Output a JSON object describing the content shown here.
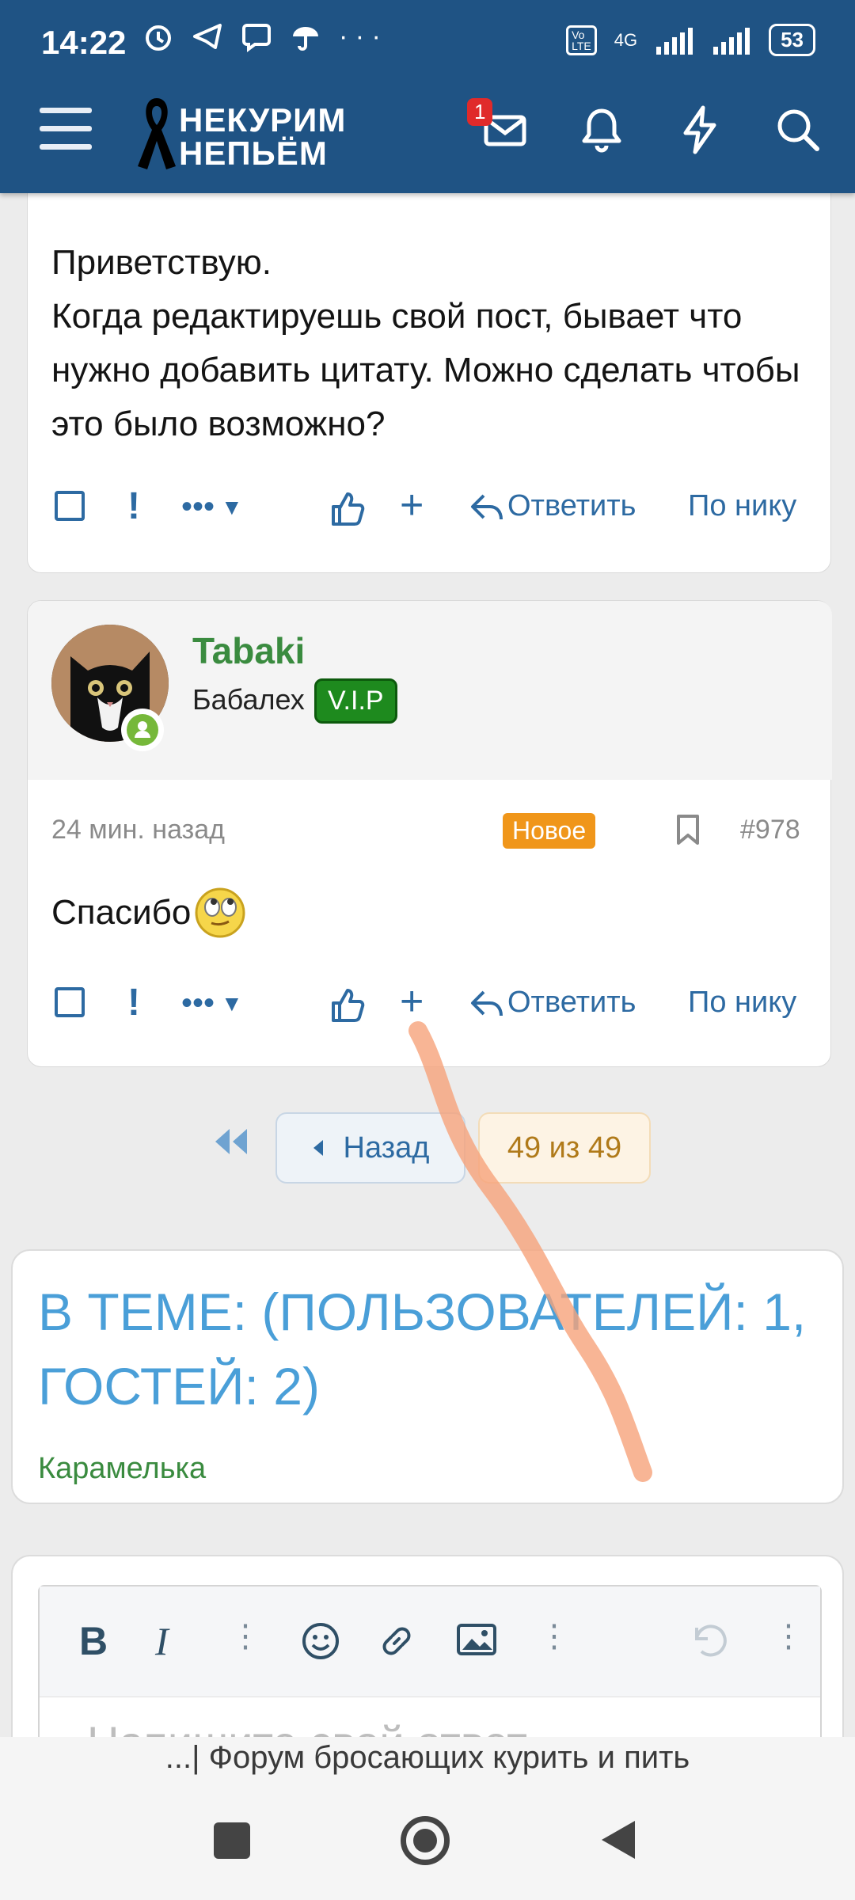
{
  "status_bar": {
    "time": "14:22",
    "network": "4G",
    "battery": "53"
  },
  "header": {
    "logo_line1": "НЕКУРИМ",
    "logo_line2": "НЕПЬЁМ",
    "messages_badge": "1"
  },
  "post1": {
    "text": "Приветствую.\nКогда редактируешь свой пост, бывает что нужно добавить цитату. Можно сделать чтобы это было возможно?",
    "reply_label": "Ответить",
    "by_nick_label": "По нику"
  },
  "post2": {
    "username": "Tabaki",
    "user_title": "Бабалех",
    "user_badge": "V.I.P",
    "time": "24 мин. назад",
    "new_badge": "Новое",
    "post_number": "#978",
    "text": "Спасибо",
    "reply_label": "Ответить",
    "by_nick_label": "По нику"
  },
  "pagination": {
    "back_label": "Назад",
    "current": "49 из 49"
  },
  "online": {
    "title": "В ТЕМЕ: (ПОЛЬЗОВАТЕЛЕЙ: 1, ГОСТЕЙ: 2)",
    "user": "Карамелька"
  },
  "editor": {
    "placeholder": "Напишите свой ответ..."
  },
  "footer": {
    "page_title": "...| Форум бросающих курить и пить"
  },
  "colors": {
    "header": "#1f5384",
    "link": "#2d6aa2",
    "username": "#3a8b3f",
    "online_title": "#4a9fd8",
    "new_badge": "#f0961a"
  }
}
